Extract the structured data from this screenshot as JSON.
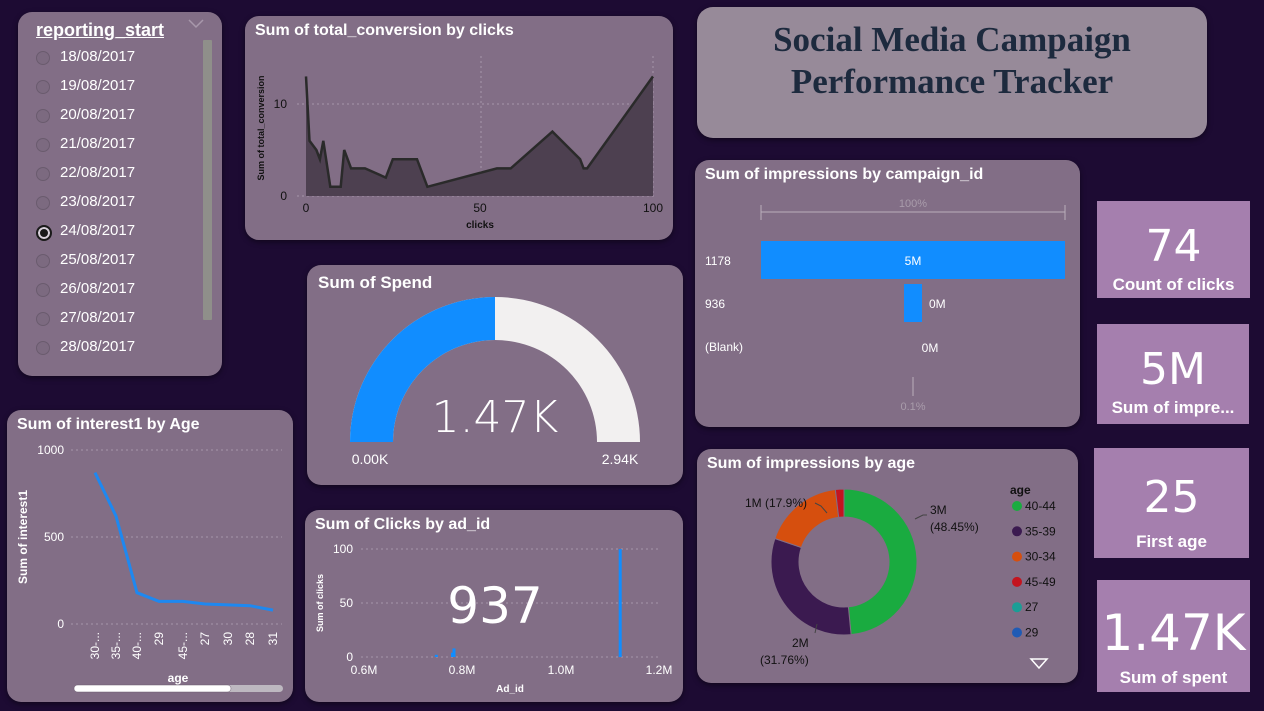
{
  "slicer": {
    "title": "reporting_start",
    "items": [
      "18/08/2017",
      "19/08/2017",
      "20/08/2017",
      "21/08/2017",
      "22/08/2017",
      "23/08/2017",
      "24/08/2017",
      "25/08/2017",
      "26/08/2017",
      "27/08/2017",
      "28/08/2017"
    ],
    "selected_index": 6
  },
  "header": {
    "title_line1": "Social Media Campaign",
    "title_line2": "Performance Tracker"
  },
  "conv_chart": {
    "title": "Sum of total_conversion by clicks",
    "ylabel": "Sum of total_conversion",
    "xlabel": "clicks",
    "xticks": [
      "0",
      "50",
      "100"
    ],
    "yticks": [
      "0",
      "10"
    ]
  },
  "interest_chart": {
    "title": "Sum of interest1 by Age",
    "ylabel": "Sum of interest1",
    "xlabel": "age",
    "yticks": [
      "0",
      "500",
      "1000"
    ],
    "xticks": [
      "30-...",
      "35-...",
      "40-...",
      "29",
      "45-...",
      "27",
      "30",
      "28",
      "31"
    ]
  },
  "gauge": {
    "title": "Sum of Spend",
    "value_label": "1.47K",
    "min_label": "0.00K",
    "max_label": "2.94K",
    "color": "#118dff"
  },
  "clicks_chart": {
    "title": "Sum of Clicks by ad_id",
    "ylabel": "Sum of clicks",
    "xlabel": "Ad_id",
    "yticks": [
      "0",
      "50",
      "100"
    ],
    "xticks": [
      "0.6M",
      "0.8M",
      "1.0M",
      "1.2M"
    ],
    "overlay_value": "937"
  },
  "funnel": {
    "title": "Sum of impressions by campaign_id",
    "top_pct": "100%",
    "bottom_pct": "0.1%",
    "rows": [
      {
        "label": "1178",
        "value_label": "5M"
      },
      {
        "label": "936",
        "value_label": "0M"
      },
      {
        "label": "(Blank)",
        "value_label": "0M"
      }
    ]
  },
  "donut": {
    "title": "Sum of impressions by age",
    "legend_title": "age",
    "legend": [
      {
        "name": "40-44",
        "color": "#1aab40"
      },
      {
        "name": "35-39",
        "color": "#3b1a50"
      },
      {
        "name": "30-34",
        "color": "#d64f0e"
      },
      {
        "name": "45-49",
        "color": "#c4141f"
      },
      {
        "name": "27",
        "color": "#1a9e96"
      },
      {
        "name": "29",
        "color": "#1f5bb5"
      }
    ],
    "labels": {
      "a_value": "3M",
      "a_pct": "(48.45%)",
      "b_value": "2M",
      "b_pct": "(31.76%)",
      "c_text": "1M (17.9%)"
    }
  },
  "kpis": {
    "clicks": {
      "value": "74",
      "label": "Count of clicks"
    },
    "impressions": {
      "value": "5M",
      "label": "Sum of impre..."
    },
    "age": {
      "value": "25",
      "label": "First age"
    },
    "spent": {
      "value": "1.47K",
      "label": "Sum of spent"
    }
  },
  "chart_data": [
    {
      "type": "area",
      "title": "Sum of total_conversion by clicks",
      "xlabel": "clicks",
      "ylabel": "Sum of total_conversion",
      "xlim": [
        -3,
        100
      ],
      "ylim": [
        0,
        12
      ],
      "x": [
        0,
        1,
        3,
        4,
        5,
        7,
        8,
        10,
        11,
        13,
        17,
        23,
        25,
        32,
        35,
        55,
        59,
        71,
        79,
        80,
        81,
        100
      ],
      "y": [
        13,
        6,
        5,
        4,
        6,
        1,
        1,
        1,
        5,
        3,
        3,
        2,
        4,
        4,
        1,
        3,
        3,
        7,
        4,
        3,
        3,
        13
      ]
    },
    {
      "type": "line",
      "title": "Sum of interest1 by Age",
      "xlabel": "age",
      "ylabel": "Sum of interest1",
      "categories": [
        "30-...",
        "35-...",
        "40-...",
        "29",
        "45-...",
        "27",
        "30",
        "28",
        "31"
      ],
      "values": [
        870,
        620,
        180,
        130,
        130,
        115,
        110,
        105,
        80
      ],
      "ylim": [
        0,
        1000
      ]
    },
    {
      "type": "gauge",
      "title": "Sum of Spend",
      "value": 1470,
      "min": 0,
      "max": 2940
    },
    {
      "type": "bar",
      "title": "Sum of Clicks by ad_id",
      "xlabel": "Ad_id",
      "ylabel": "Sum of clicks",
      "xlim": [
        600000,
        1200000
      ],
      "ylim": [
        0,
        100
      ],
      "x": [
        747000,
        780000,
        783000,
        1121000
      ],
      "values": [
        2,
        4,
        8,
        100
      ]
    },
    {
      "type": "bar",
      "title": "Sum of impressions by campaign_id",
      "categories": [
        "1178",
        "936",
        "(Blank)"
      ],
      "values": [
        5000000,
        300000,
        0
      ],
      "value_labels": [
        "5M",
        "0M",
        "0M"
      ]
    },
    {
      "type": "pie",
      "title": "Sum of impressions by age",
      "categories": [
        "40-44",
        "35-39",
        "30-34",
        "45-49"
      ],
      "values": [
        48.45,
        31.76,
        17.9,
        1.89
      ],
      "value_labels": [
        "3M",
        "2M",
        "1M",
        ""
      ]
    }
  ]
}
